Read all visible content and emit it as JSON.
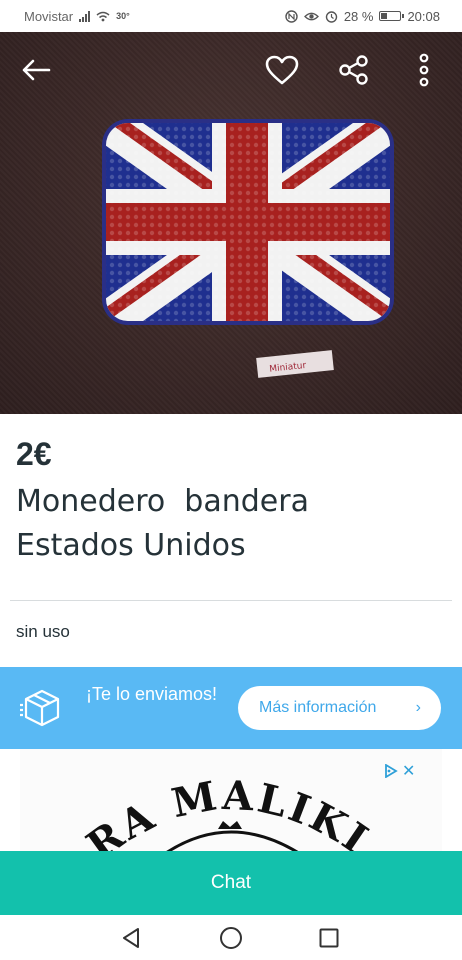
{
  "status_bar": {
    "carrier": "Movistar",
    "temperature": "30°",
    "battery_text": "28 %",
    "battery_level": 0.28,
    "time": "20:08"
  },
  "hero": {
    "icons": [
      "back-arrow-icon",
      "heart-icon",
      "share-icon",
      "more-vertical-icon"
    ],
    "colors": {
      "background": "#3b2827",
      "flag_blue": "#1f2f8f",
      "flag_red": "#a8211f",
      "flag_white": "#f2f2f2"
    }
  },
  "product": {
    "price": "2€",
    "title": "Monedero  bandera\nEstados Unidos",
    "condition": "sin uso"
  },
  "shipping": {
    "text": "¡Te lo enviamos!",
    "button_label": "Más información",
    "button_chevron": "›",
    "color": "#59b9f4"
  },
  "ad": {
    "logo_text": "RA MALIKIAN",
    "icons": [
      "ad-choices-icon",
      "close-icon"
    ],
    "close_glyph": "✕"
  },
  "chat": {
    "label": "Chat",
    "color": "#13c1ac"
  },
  "nav": {
    "icons": [
      "nav-back-icon",
      "nav-home-icon",
      "nav-recent-icon"
    ]
  }
}
